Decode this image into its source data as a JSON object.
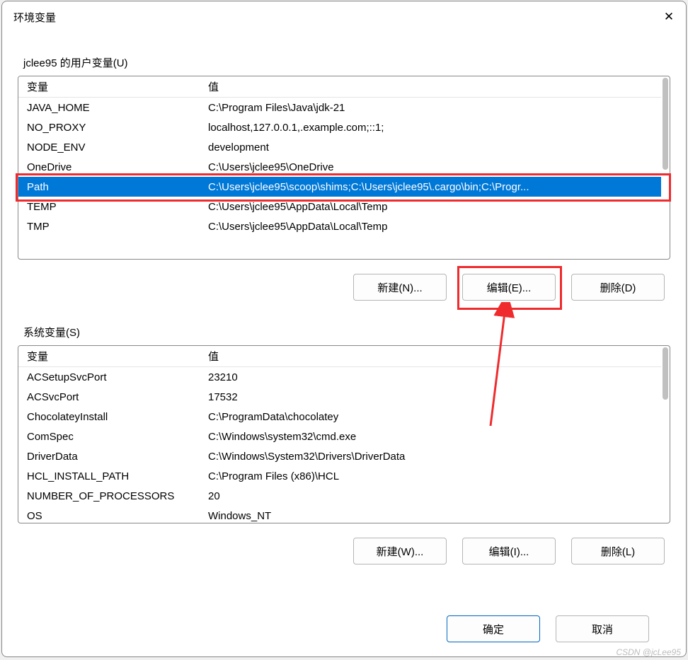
{
  "window": {
    "title": "环境变量"
  },
  "user_section": {
    "label": "jclee95 的用户变量(U)",
    "headers": {
      "name": "变量",
      "value": "值"
    },
    "rows": [
      {
        "name": "JAVA_HOME",
        "value": "C:\\Program Files\\Java\\jdk-21"
      },
      {
        "name": "NO_PROXY",
        "value": "localhost,127.0.0.1,.example.com;::1;"
      },
      {
        "name": "NODE_ENV",
        "value": "development"
      },
      {
        "name": "OneDrive",
        "value": "C:\\Users\\jclee95\\OneDrive"
      },
      {
        "name": "Path",
        "value": "C:\\Users\\jclee95\\scoop\\shims;C:\\Users\\jclee95\\.cargo\\bin;C:\\Progr..."
      },
      {
        "name": "TEMP",
        "value": "C:\\Users\\jclee95\\AppData\\Local\\Temp"
      },
      {
        "name": "TMP",
        "value": "C:\\Users\\jclee95\\AppData\\Local\\Temp"
      }
    ],
    "selected_index": 4,
    "buttons": {
      "new": "新建(N)...",
      "edit": "编辑(E)...",
      "delete": "删除(D)"
    }
  },
  "system_section": {
    "label": "系统变量(S)",
    "headers": {
      "name": "变量",
      "value": "值"
    },
    "rows": [
      {
        "name": "ACSetupSvcPort",
        "value": "23210"
      },
      {
        "name": "ACSvcPort",
        "value": "17532"
      },
      {
        "name": "ChocolateyInstall",
        "value": "C:\\ProgramData\\chocolatey"
      },
      {
        "name": "ComSpec",
        "value": "C:\\Windows\\system32\\cmd.exe"
      },
      {
        "name": "DriverData",
        "value": "C:\\Windows\\System32\\Drivers\\DriverData"
      },
      {
        "name": "HCL_INSTALL_PATH",
        "value": "C:\\Program Files (x86)\\HCL"
      },
      {
        "name": "NUMBER_OF_PROCESSORS",
        "value": "20"
      },
      {
        "name": "OS",
        "value": "Windows_NT"
      }
    ],
    "buttons": {
      "new": "新建(W)...",
      "edit": "编辑(I)...",
      "delete": "删除(L)"
    }
  },
  "footer": {
    "ok": "确定",
    "cancel": "取消"
  },
  "watermark": "CSDN @jcLee95"
}
